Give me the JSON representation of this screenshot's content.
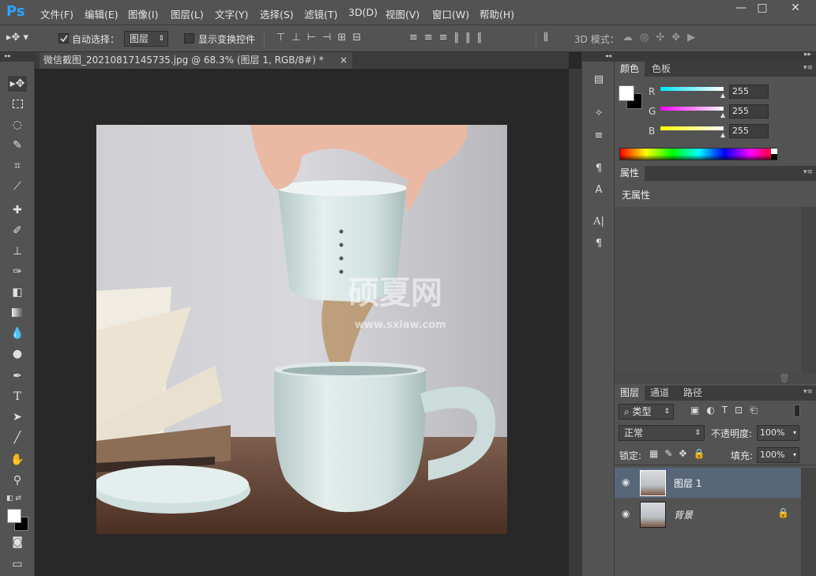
{
  "app": {
    "logo": "Ps",
    "menus": [
      "文件(F)",
      "编辑(E)",
      "图像(I)",
      "图层(L)",
      "文字(Y)",
      "选择(S)",
      "滤镜(T)",
      "3D(D)",
      "视图(V)",
      "窗口(W)",
      "帮助(H)"
    ],
    "window_buttons": [
      "—",
      "□",
      "✕"
    ]
  },
  "options": {
    "auto_select_label": "自动选择：",
    "auto_select_value": "图层",
    "show_transform_label": "显示变换控件",
    "mode_3d_label": "3D 模式："
  },
  "document": {
    "tab_title": "微信截图_20210817145735.jpg @ 68.3% (图层 1, RGB/8#) *",
    "close": "×",
    "watermark_title": "硕夏网",
    "watermark_url": "www.sxiaw.com"
  },
  "color_panel": {
    "tabs": [
      "颜色",
      "色板"
    ],
    "channels": [
      {
        "label": "R",
        "value": "255"
      },
      {
        "label": "G",
        "value": "255"
      },
      {
        "label": "B",
        "value": "255"
      }
    ],
    "colors": {
      "foreground": "#ffffff",
      "background": "#000000",
      "r_bar": "#00e5ff",
      "g_bar": "#ff00ff",
      "b_bar": "#ffff00"
    }
  },
  "properties_panel": {
    "tab": "属性",
    "empty_text": "无属性"
  },
  "layers_panel": {
    "tabs": [
      "图层",
      "通道",
      "路径"
    ],
    "filter_kind": "类型",
    "blend_mode": "正常",
    "opacity_label": "不透明度:",
    "opacity_value": "100%",
    "lock_label": "锁定:",
    "fill_label": "填充:",
    "fill_value": "100%",
    "layers": [
      {
        "name": "图层 1",
        "selected": true
      },
      {
        "name": "背景",
        "locked": true
      }
    ]
  }
}
